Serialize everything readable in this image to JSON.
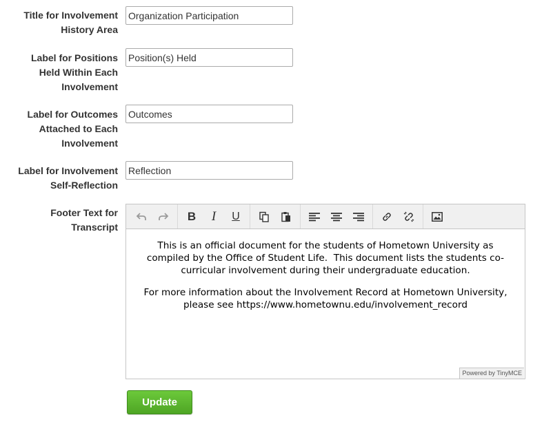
{
  "fields": [
    {
      "label_lines": [
        "Title for Involvement",
        "History Area"
      ],
      "value": "Organization Participation"
    },
    {
      "label_lines": [
        "Label for Positions",
        "Held Within Each",
        "Involvement"
      ],
      "value": "Position(s) Held"
    },
    {
      "label_lines": [
        "Label for Outcomes",
        "Attached to Each",
        "Involvement"
      ],
      "value": "Outcomes"
    },
    {
      "label_lines": [
        "Label for Involvement",
        "Self-Reflection"
      ],
      "value": "Reflection"
    }
  ],
  "footer": {
    "label_lines": [
      "Footer Text for",
      "Transcript"
    ],
    "paragraphs": [
      "This is an official document for the students of Hometown University as compiled by the Office of Student Life.  This document lists the students co-curricular involvement during their undergraduate education.",
      "For more information about the Involvement Record at Hometown University, please see https://www.hometownu.edu/involvement_record"
    ],
    "powered_by": "Powered by TinyMCE"
  },
  "toolbar_icons": [
    "undo-icon",
    "redo-icon",
    "bold-icon",
    "italic-icon",
    "underline-icon",
    "copy-icon",
    "paste-icon",
    "align-left-icon",
    "align-center-icon",
    "align-right-icon",
    "link-icon",
    "unlink-icon",
    "image-icon"
  ],
  "colors": {
    "update_button": "#56b02c",
    "label_text": "#333333"
  },
  "update_label": "Update"
}
